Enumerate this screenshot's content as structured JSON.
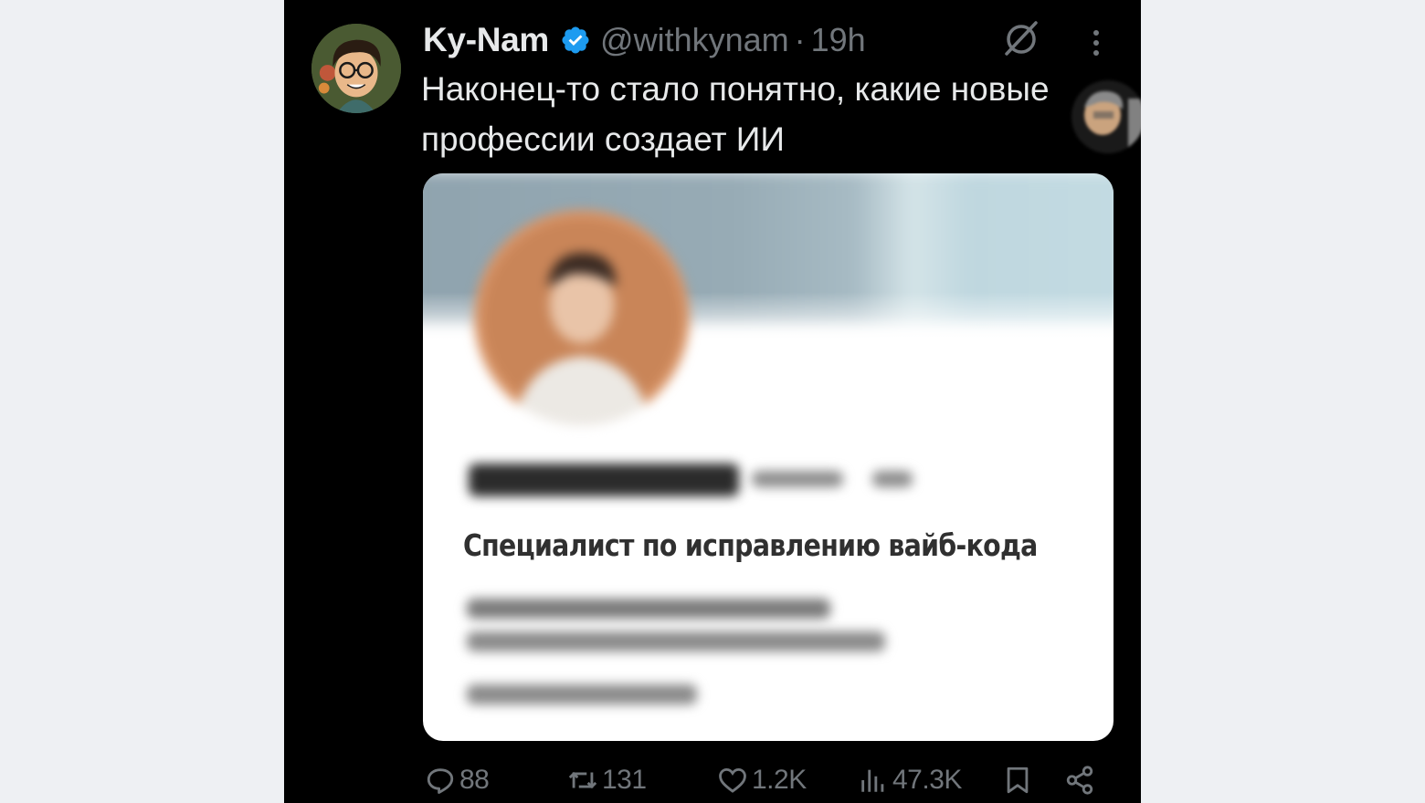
{
  "tweet": {
    "author_name": "Ky-Nam",
    "handle": "@withkynam",
    "separator": "·",
    "time": "19h",
    "text": "Наконец-то стало понятно, какие новые профессии создает ИИ"
  },
  "card": {
    "job_title": "Специалист по исправлению вайб-кода"
  },
  "actions": {
    "replies": "88",
    "reposts": "131",
    "likes": "1.2K",
    "views": "47.3K"
  },
  "icons": {
    "verified": "verified-badge-icon",
    "grok": "grok-icon",
    "more": "more-vertical-icon",
    "reply": "reply-icon",
    "repost": "repost-icon",
    "like": "heart-icon",
    "views": "views-icon",
    "bookmark": "bookmark-icon",
    "share": "share-icon"
  },
  "colors": {
    "background": "#000000",
    "text": "#e7e9ea",
    "muted": "#71767b",
    "verified_blue": "#1d9bf0",
    "card_background": "#ffffff",
    "page_outside": "#eef0f3"
  }
}
